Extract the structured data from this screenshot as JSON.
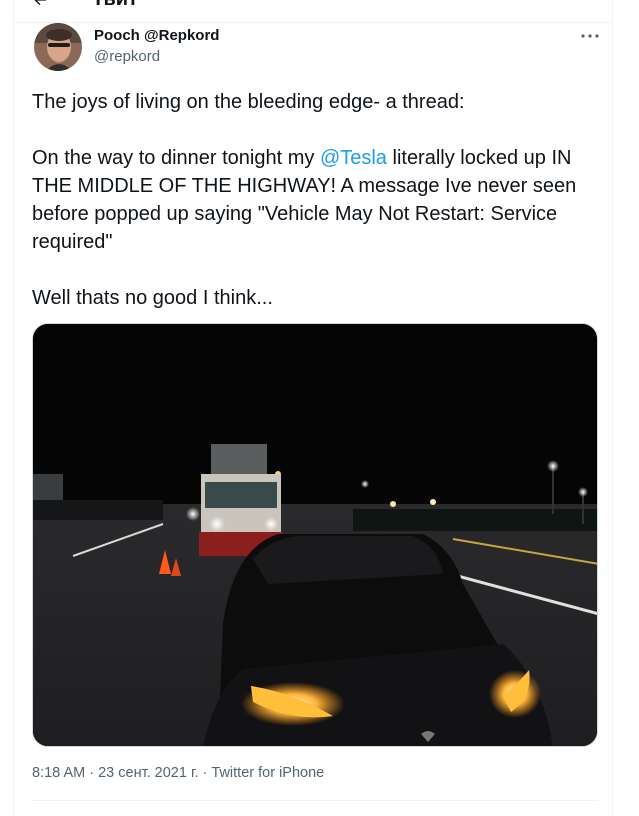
{
  "header": {
    "title": "Твит",
    "back_icon": "arrow-left-icon"
  },
  "tweet": {
    "author_name": "Pooch @Repkord",
    "author_handle": "@repkord",
    "more_icon": "more-horizontal-icon",
    "paragraph1": "The joys of living on the bleeding edge- a thread:",
    "paragraph2_before": "On the way to dinner tonight my ",
    "mention": "@Tesla",
    "paragraph2_after": " literally locked up IN THE MIDDLE OF THE HIGHWAY! A message Ive never seen before popped up saying \"Vehicle May Not Restart: Service required\"",
    "paragraph3": "Well thats no good I think...",
    "time": "8:18 AM",
    "separator": " · ",
    "date": "23 сент. 2021 г.",
    "source": "Twitter for iPhone"
  },
  "colors": {
    "text": "#0f1419",
    "secondary": "#536471",
    "link": "#1d9bf0",
    "border": "#eff3f4"
  }
}
